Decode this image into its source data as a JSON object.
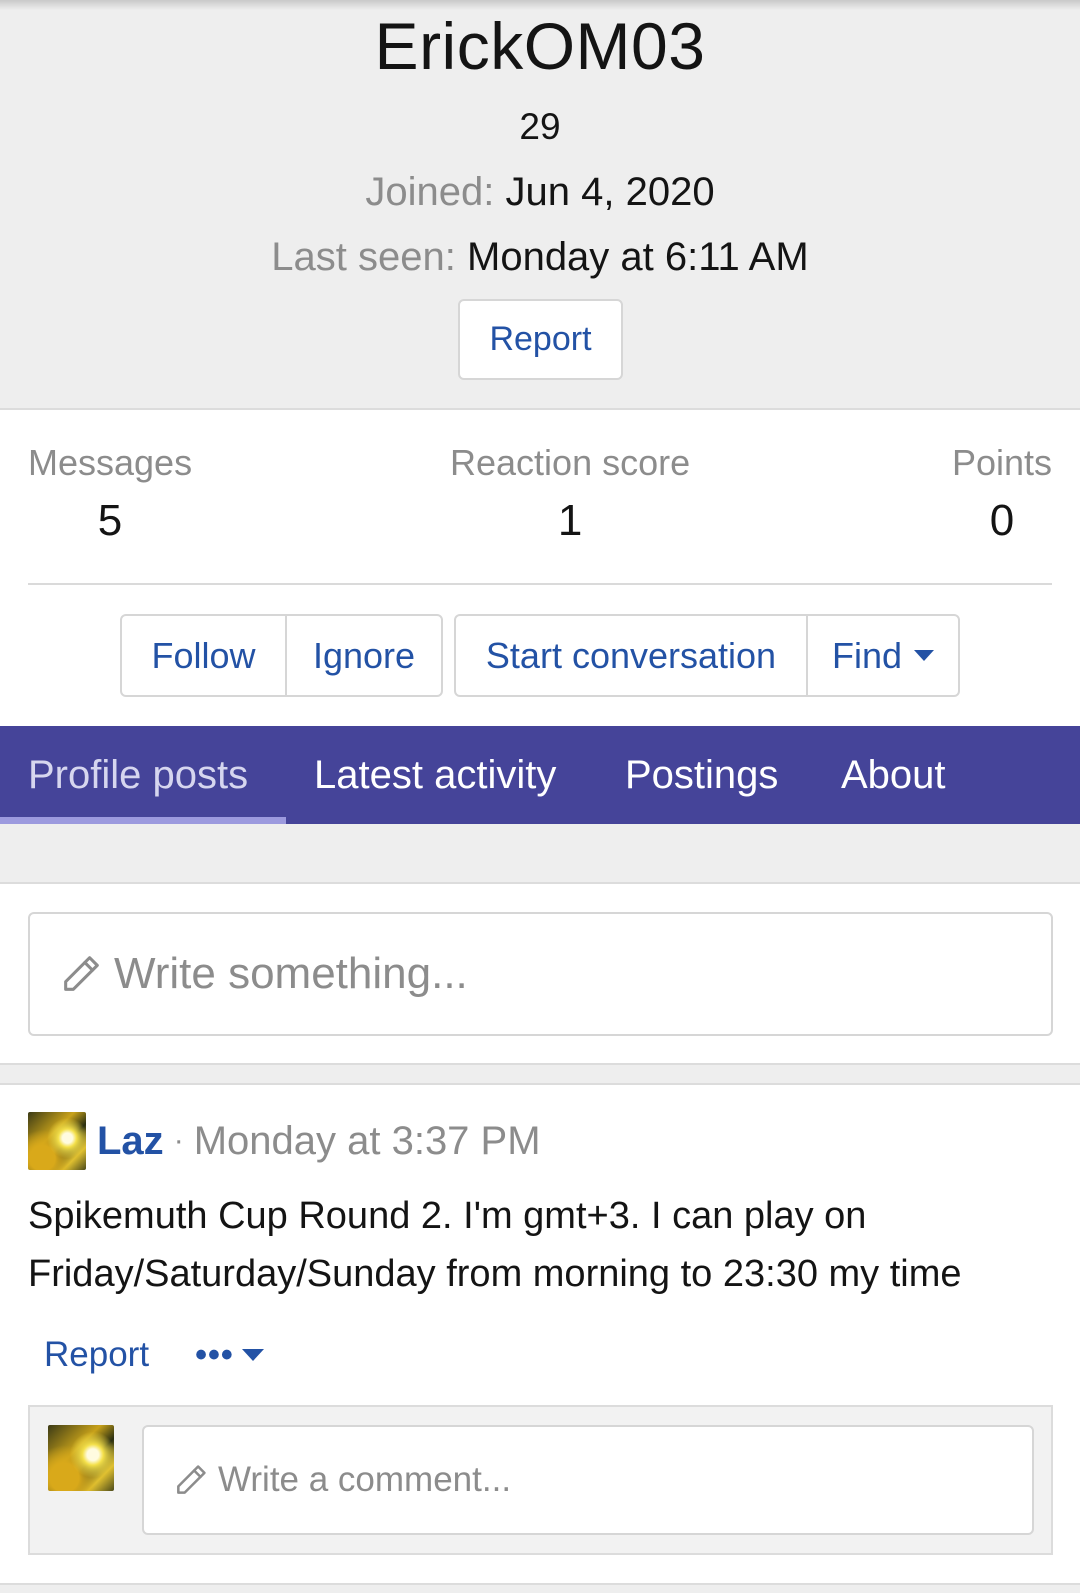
{
  "profile": {
    "username": "ErickOM03",
    "age": "29",
    "joined_label": "Joined:",
    "joined_value": "Jun 4, 2020",
    "last_seen_label": "Last seen:",
    "last_seen_value": "Monday at 6:11 AM",
    "report_label": "Report"
  },
  "stats": {
    "messages_label": "Messages",
    "messages_value": "5",
    "reaction_label": "Reaction score",
    "reaction_value": "1",
    "points_label": "Points",
    "points_value": "0"
  },
  "actions": {
    "follow": "Follow",
    "ignore": "Ignore",
    "start_conversation": "Start conversation",
    "find": "Find"
  },
  "tabs": [
    {
      "label": "Profile posts",
      "active": true
    },
    {
      "label": "Latest activity",
      "active": false
    },
    {
      "label": "Postings",
      "active": false
    },
    {
      "label": "About",
      "active": false
    }
  ],
  "composer": {
    "placeholder": "Write something..."
  },
  "post": {
    "author": "Laz",
    "separator": "·",
    "time": "Monday at 3:37 PM",
    "body": "Spikemuth Cup Round 2. I'm gmt+3. I can play on Friday/Saturday/Sunday from morning to 23:30 my time",
    "report_label": "Report",
    "more_label": "•••",
    "comment_placeholder": "Write a comment..."
  },
  "colors": {
    "link": "#2352a5",
    "tab_bar": "#454499",
    "tab_active_text": "#d6d6ef",
    "muted": "#8c8c8c"
  }
}
